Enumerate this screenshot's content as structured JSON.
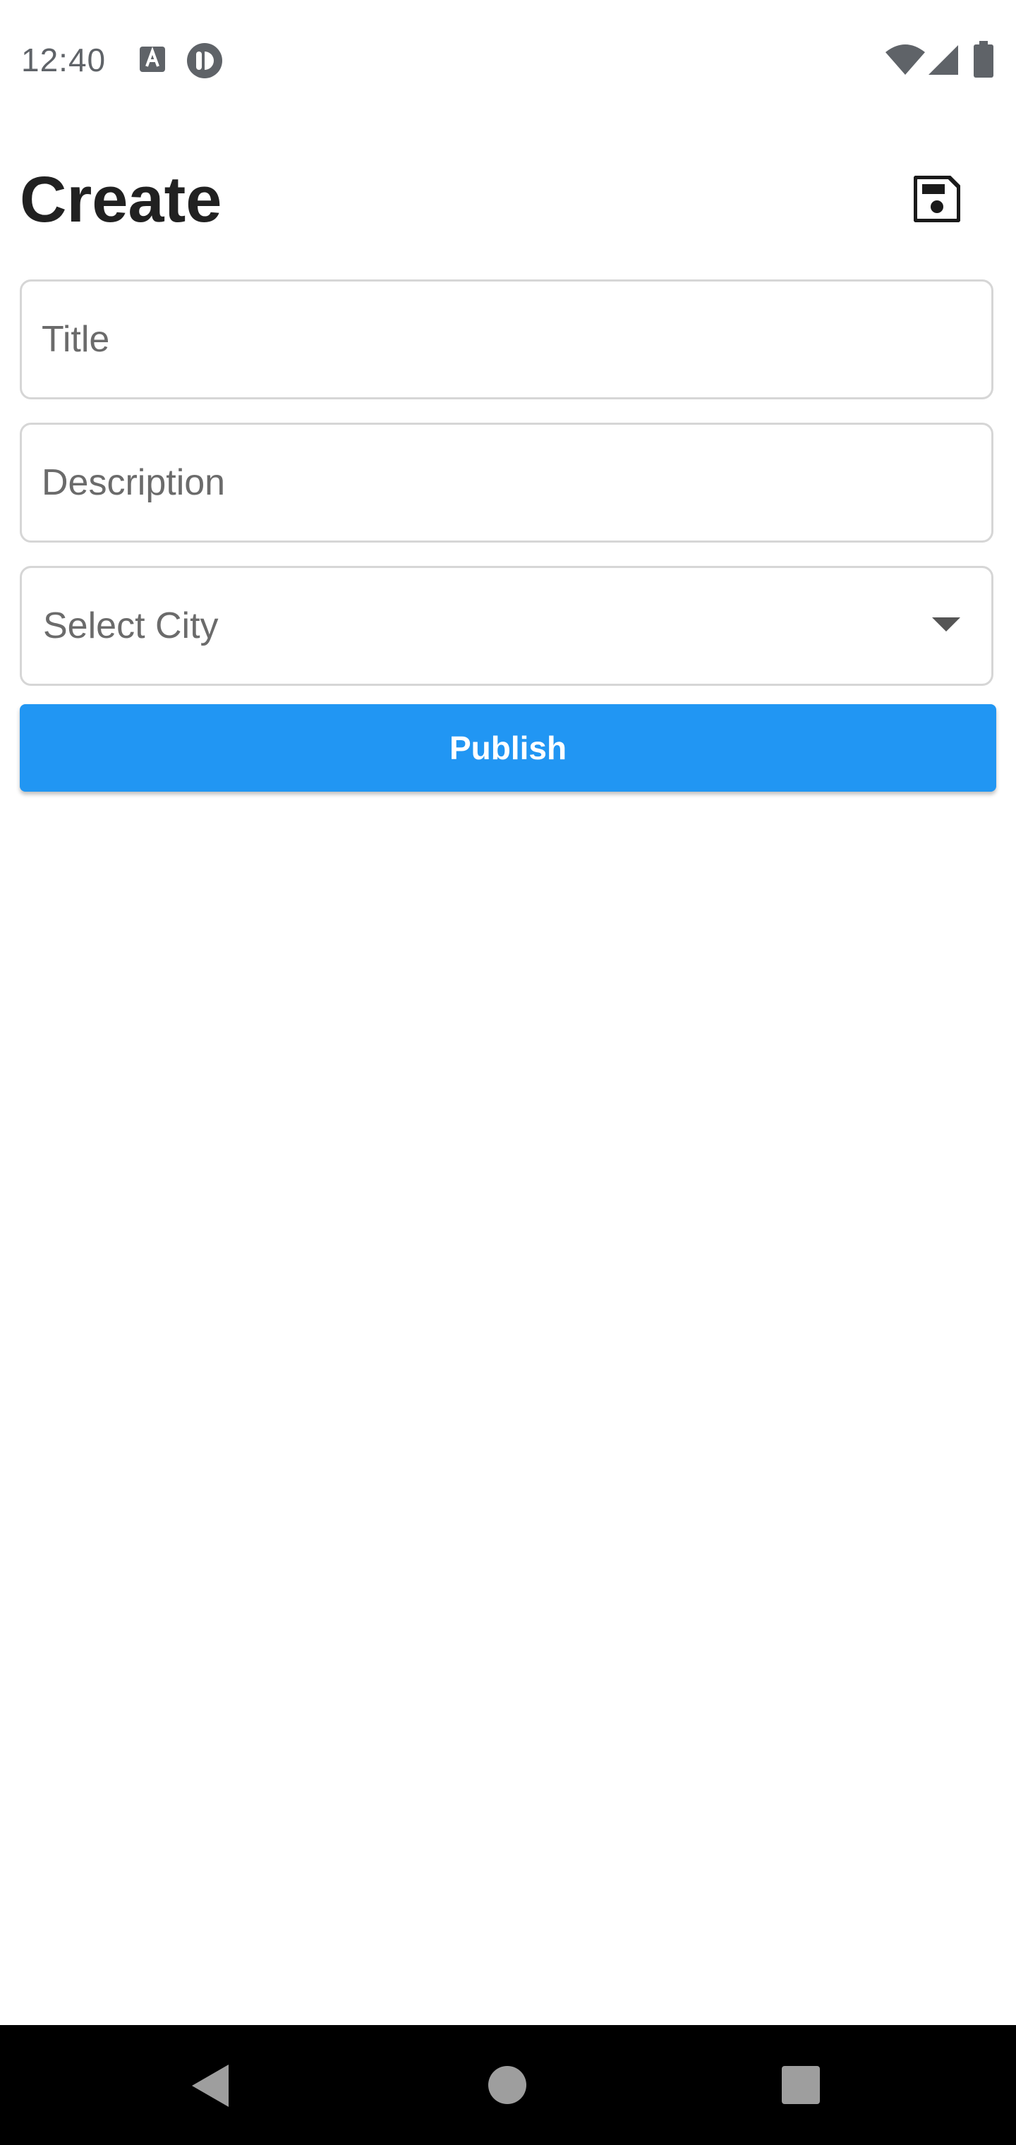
{
  "status_bar": {
    "time": "12:40",
    "notification_icons": [
      "font-download-icon",
      "app-notification-icon"
    ],
    "system_icons": [
      "wifi-icon",
      "cellular-signal-icon",
      "battery-icon"
    ]
  },
  "header": {
    "title": "Create",
    "save_icon": "floppy-disk-save-icon"
  },
  "form": {
    "title_field": {
      "placeholder": "Title",
      "value": ""
    },
    "description_field": {
      "placeholder": "Description",
      "value": ""
    },
    "city_select": {
      "label": "Select City",
      "icon": "dropdown-arrow-icon"
    }
  },
  "actions": {
    "publish_label": "Publish",
    "publish_color": "#2196f3"
  },
  "nav_bar": {
    "buttons": [
      "back",
      "home",
      "recents"
    ]
  }
}
